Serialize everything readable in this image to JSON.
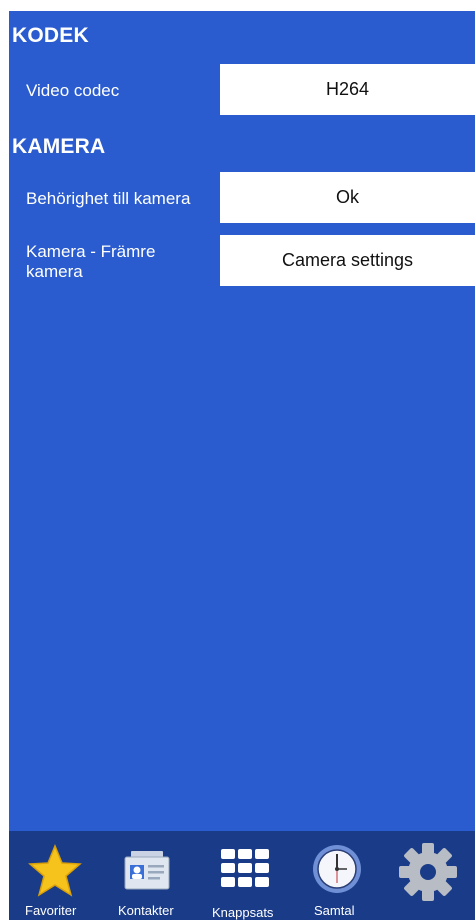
{
  "sections": {
    "codec": {
      "title": "KODEK",
      "video_codec": {
        "label": "Video codec",
        "value": "H264"
      }
    },
    "camera": {
      "title": "KAMERA",
      "permission": {
        "label": "Behörighet till kamera",
        "value": "Ok"
      },
      "front_camera": {
        "label": "Kamera - Främre kamera",
        "value": "Camera settings"
      }
    }
  },
  "tabbar": {
    "items": [
      {
        "label": "Favoriter",
        "icon": "star-icon"
      },
      {
        "label": "Kontakter",
        "icon": "contact-card-icon"
      },
      {
        "label": "Knappsats",
        "icon": "keypad-icon"
      },
      {
        "label": "Samtal",
        "icon": "clock-icon"
      },
      {
        "label": "",
        "icon": "gear-icon"
      }
    ]
  },
  "colors": {
    "background": "#2a5ccf",
    "tabbar": "#1a3c88",
    "button": "#ffffff",
    "star": "#f6c21c"
  }
}
